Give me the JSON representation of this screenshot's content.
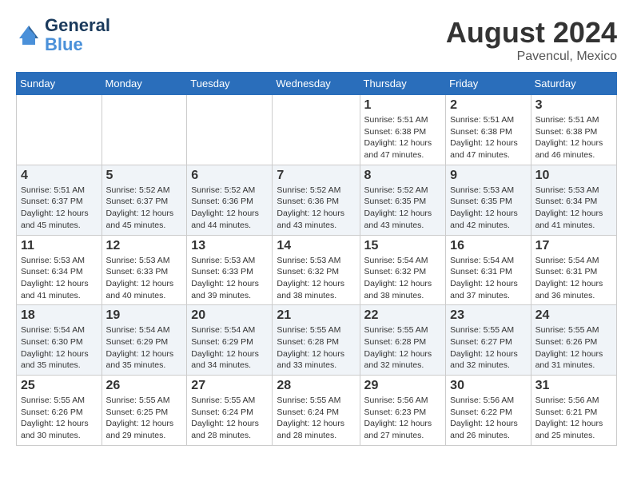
{
  "header": {
    "logo_line1": "General",
    "logo_line2": "Blue",
    "month_year": "August 2024",
    "location": "Pavencul, Mexico"
  },
  "weekdays": [
    "Sunday",
    "Monday",
    "Tuesday",
    "Wednesday",
    "Thursday",
    "Friday",
    "Saturday"
  ],
  "weeks": [
    [
      {
        "day": "",
        "info": ""
      },
      {
        "day": "",
        "info": ""
      },
      {
        "day": "",
        "info": ""
      },
      {
        "day": "",
        "info": ""
      },
      {
        "day": "1",
        "info": "Sunrise: 5:51 AM\nSunset: 6:38 PM\nDaylight: 12 hours\nand 47 minutes."
      },
      {
        "day": "2",
        "info": "Sunrise: 5:51 AM\nSunset: 6:38 PM\nDaylight: 12 hours\nand 47 minutes."
      },
      {
        "day": "3",
        "info": "Sunrise: 5:51 AM\nSunset: 6:38 PM\nDaylight: 12 hours\nand 46 minutes."
      }
    ],
    [
      {
        "day": "4",
        "info": "Sunrise: 5:51 AM\nSunset: 6:37 PM\nDaylight: 12 hours\nand 45 minutes."
      },
      {
        "day": "5",
        "info": "Sunrise: 5:52 AM\nSunset: 6:37 PM\nDaylight: 12 hours\nand 45 minutes."
      },
      {
        "day": "6",
        "info": "Sunrise: 5:52 AM\nSunset: 6:36 PM\nDaylight: 12 hours\nand 44 minutes."
      },
      {
        "day": "7",
        "info": "Sunrise: 5:52 AM\nSunset: 6:36 PM\nDaylight: 12 hours\nand 43 minutes."
      },
      {
        "day": "8",
        "info": "Sunrise: 5:52 AM\nSunset: 6:35 PM\nDaylight: 12 hours\nand 43 minutes."
      },
      {
        "day": "9",
        "info": "Sunrise: 5:53 AM\nSunset: 6:35 PM\nDaylight: 12 hours\nand 42 minutes."
      },
      {
        "day": "10",
        "info": "Sunrise: 5:53 AM\nSunset: 6:34 PM\nDaylight: 12 hours\nand 41 minutes."
      }
    ],
    [
      {
        "day": "11",
        "info": "Sunrise: 5:53 AM\nSunset: 6:34 PM\nDaylight: 12 hours\nand 41 minutes."
      },
      {
        "day": "12",
        "info": "Sunrise: 5:53 AM\nSunset: 6:33 PM\nDaylight: 12 hours\nand 40 minutes."
      },
      {
        "day": "13",
        "info": "Sunrise: 5:53 AM\nSunset: 6:33 PM\nDaylight: 12 hours\nand 39 minutes."
      },
      {
        "day": "14",
        "info": "Sunrise: 5:53 AM\nSunset: 6:32 PM\nDaylight: 12 hours\nand 38 minutes."
      },
      {
        "day": "15",
        "info": "Sunrise: 5:54 AM\nSunset: 6:32 PM\nDaylight: 12 hours\nand 38 minutes."
      },
      {
        "day": "16",
        "info": "Sunrise: 5:54 AM\nSunset: 6:31 PM\nDaylight: 12 hours\nand 37 minutes."
      },
      {
        "day": "17",
        "info": "Sunrise: 5:54 AM\nSunset: 6:31 PM\nDaylight: 12 hours\nand 36 minutes."
      }
    ],
    [
      {
        "day": "18",
        "info": "Sunrise: 5:54 AM\nSunset: 6:30 PM\nDaylight: 12 hours\nand 35 minutes."
      },
      {
        "day": "19",
        "info": "Sunrise: 5:54 AM\nSunset: 6:29 PM\nDaylight: 12 hours\nand 35 minutes."
      },
      {
        "day": "20",
        "info": "Sunrise: 5:54 AM\nSunset: 6:29 PM\nDaylight: 12 hours\nand 34 minutes."
      },
      {
        "day": "21",
        "info": "Sunrise: 5:55 AM\nSunset: 6:28 PM\nDaylight: 12 hours\nand 33 minutes."
      },
      {
        "day": "22",
        "info": "Sunrise: 5:55 AM\nSunset: 6:28 PM\nDaylight: 12 hours\nand 32 minutes."
      },
      {
        "day": "23",
        "info": "Sunrise: 5:55 AM\nSunset: 6:27 PM\nDaylight: 12 hours\nand 32 minutes."
      },
      {
        "day": "24",
        "info": "Sunrise: 5:55 AM\nSunset: 6:26 PM\nDaylight: 12 hours\nand 31 minutes."
      }
    ],
    [
      {
        "day": "25",
        "info": "Sunrise: 5:55 AM\nSunset: 6:26 PM\nDaylight: 12 hours\nand 30 minutes."
      },
      {
        "day": "26",
        "info": "Sunrise: 5:55 AM\nSunset: 6:25 PM\nDaylight: 12 hours\nand 29 minutes."
      },
      {
        "day": "27",
        "info": "Sunrise: 5:55 AM\nSunset: 6:24 PM\nDaylight: 12 hours\nand 28 minutes."
      },
      {
        "day": "28",
        "info": "Sunrise: 5:55 AM\nSunset: 6:24 PM\nDaylight: 12 hours\nand 28 minutes."
      },
      {
        "day": "29",
        "info": "Sunrise: 5:56 AM\nSunset: 6:23 PM\nDaylight: 12 hours\nand 27 minutes."
      },
      {
        "day": "30",
        "info": "Sunrise: 5:56 AM\nSunset: 6:22 PM\nDaylight: 12 hours\nand 26 minutes."
      },
      {
        "day": "31",
        "info": "Sunrise: 5:56 AM\nSunset: 6:21 PM\nDaylight: 12 hours\nand 25 minutes."
      }
    ]
  ]
}
